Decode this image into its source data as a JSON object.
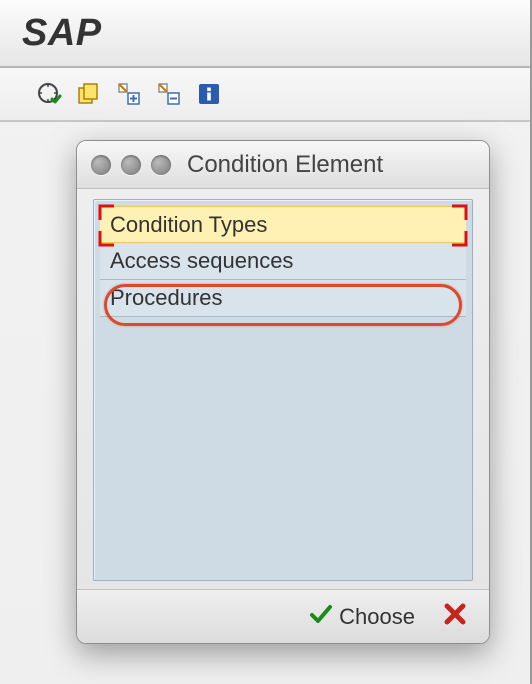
{
  "app": {
    "title": "SAP"
  },
  "toolbar": {
    "icons": [
      "clock-check-icon",
      "copy-stack-icon",
      "node-add-icon",
      "node-remove-icon",
      "info-icon"
    ]
  },
  "dialog": {
    "title": "Condition Element",
    "options": [
      {
        "label": "Condition Types",
        "selected": true,
        "circled": false
      },
      {
        "label": "Access sequences",
        "selected": false,
        "circled": false
      },
      {
        "label": "Procedures",
        "selected": false,
        "circled": true
      }
    ],
    "choose_label": "Choose"
  }
}
